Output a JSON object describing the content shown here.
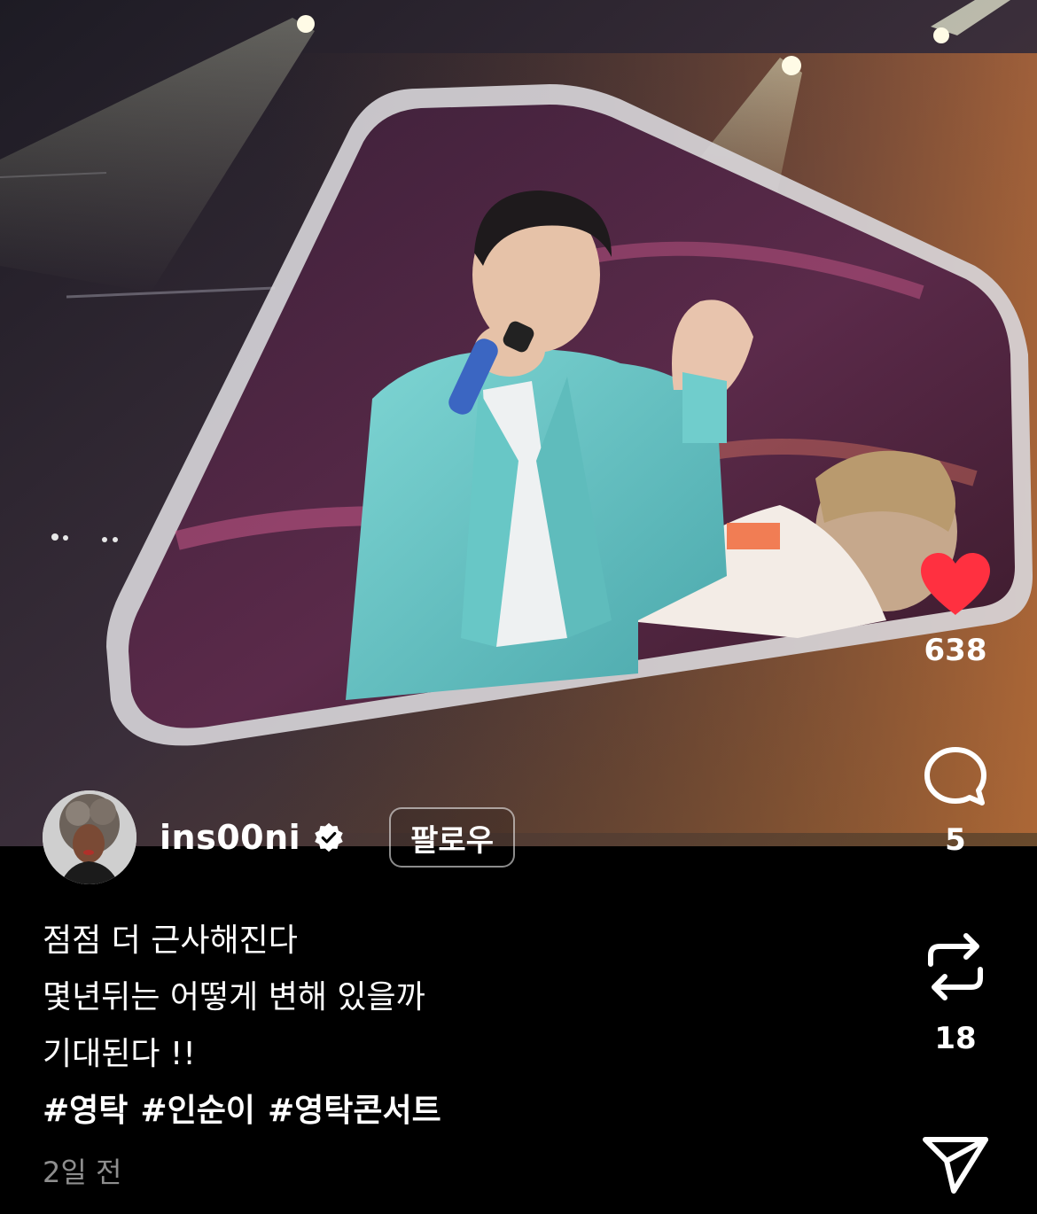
{
  "author": {
    "username": "ins00ni",
    "verified": true,
    "follow_label": "팔로우"
  },
  "caption": {
    "lines": [
      "점점 더 근사해진다",
      "몇년뒤는 어떻게 변해 있을까",
      "기대된다 !!"
    ],
    "hashtags": [
      "#영탁",
      "#인순이",
      "#영탁콘서트"
    ]
  },
  "timestamp": "2일 전",
  "actions": {
    "like": {
      "count": "638",
      "icon": "heart-filled-icon",
      "color": "#ff3040"
    },
    "comment": {
      "count": "5",
      "icon": "comment-bubble-icon"
    },
    "repost": {
      "count": "18",
      "icon": "repost-icon"
    },
    "share": {
      "icon": "send-icon"
    }
  },
  "colors": {
    "background": "#000000",
    "text": "#ffffff",
    "muted": "#8e8e8e",
    "like": "#ff3040"
  }
}
